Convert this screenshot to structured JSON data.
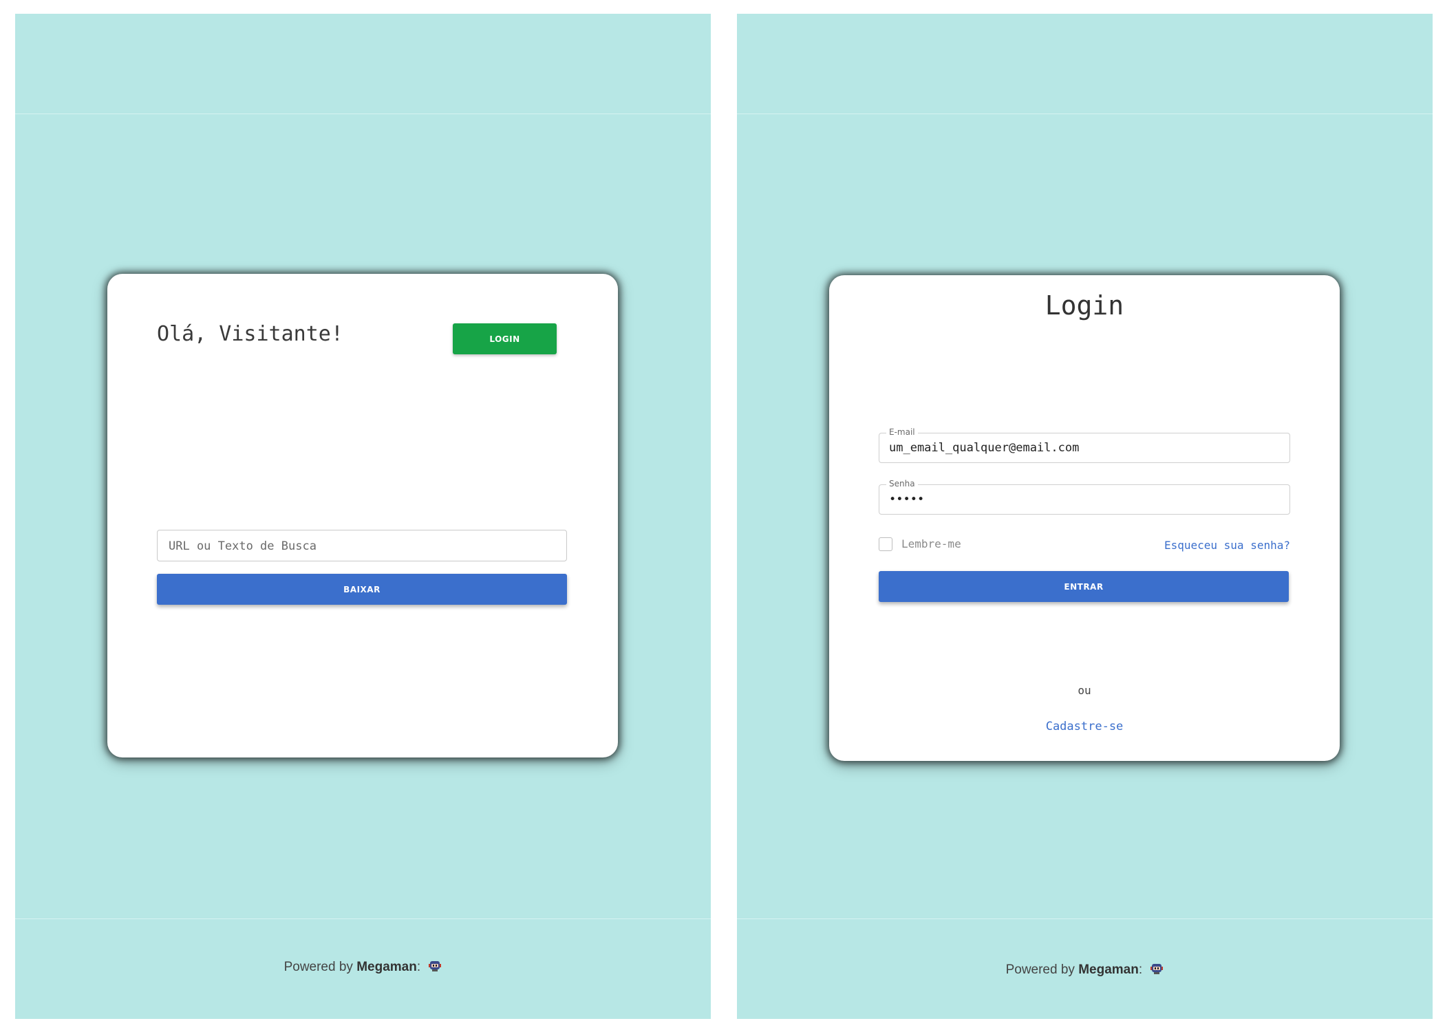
{
  "home": {
    "greeting": "Olá, Visitante!",
    "login_button": "LOGIN",
    "search_placeholder": "URL ou Texto de Busca",
    "download_button": "BAIXAR"
  },
  "login": {
    "title": "Login",
    "email_label": "E-mail",
    "email_value": "um_email_qualquer@email.com",
    "password_label": "Senha",
    "password_value": "•••••",
    "remember_label": "Lembre-me",
    "remember_checked": false,
    "forgot_link": "Esqueceu sua senha?",
    "enter_button": "ENTRAR",
    "or_text": "ou",
    "signup_link": "Cadastre-se"
  },
  "footer": {
    "powered_prefix": "Powered by",
    "brand": "Megaman",
    "colon": ":",
    "icon": "robot-icon"
  },
  "colors": {
    "background": "#b7e7e5",
    "card": "#ffffff",
    "login_button": "#17a447",
    "primary_button": "#3b6fcc",
    "link": "#3b6fcc"
  }
}
